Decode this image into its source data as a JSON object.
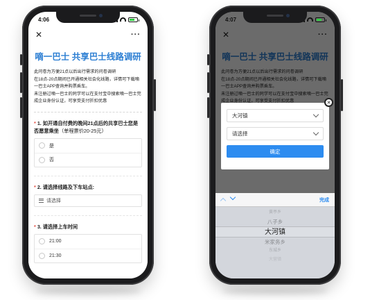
{
  "left": {
    "status": {
      "time": "4:06"
    },
    "nav": {
      "close": "✕",
      "more": "···"
    },
    "title": "嘀一巴士 共享巴士线路调研",
    "intro": [
      "此问卷为方便21点以后出行需求的问卷调研",
      "在18点-20点期间已开通相关社会化线路，详情可下载嘀一巴士APP查询并购票乘车。",
      "未注册过嘀一巴士的同学可以在支付宝中搜索嘀一巴士完成企业身份认证，可享受支付折扣优惠"
    ],
    "q1": {
      "required": "*",
      "label": "1. 如开通自付费的晚间21点后的共享巴士您是否愿意乘坐",
      "hint": "（单程票价20-25元）",
      "options": [
        "是",
        "否"
      ]
    },
    "q2": {
      "required": "*",
      "label": "2. 请选择线路及下车站点:",
      "placeholder": "请选择"
    },
    "q3": {
      "required": "*",
      "label": "3. 请选择上车时间",
      "options": [
        "21:00",
        "21:30"
      ]
    }
  },
  "right": {
    "status": {
      "time": "4:07"
    },
    "nav": {
      "close": "✕",
      "more": "···"
    },
    "modal": {
      "dropdown1": "大河镇",
      "dropdown2": "请选择",
      "confirm": "确定",
      "close": "✕"
    },
    "picker": {
      "done": "完成",
      "items": [
        "黄亭乡",
        "八子乡",
        "大河镇",
        "米家务乡",
        "东城乡",
        "大营镇"
      ],
      "selected_index": 2
    }
  }
}
